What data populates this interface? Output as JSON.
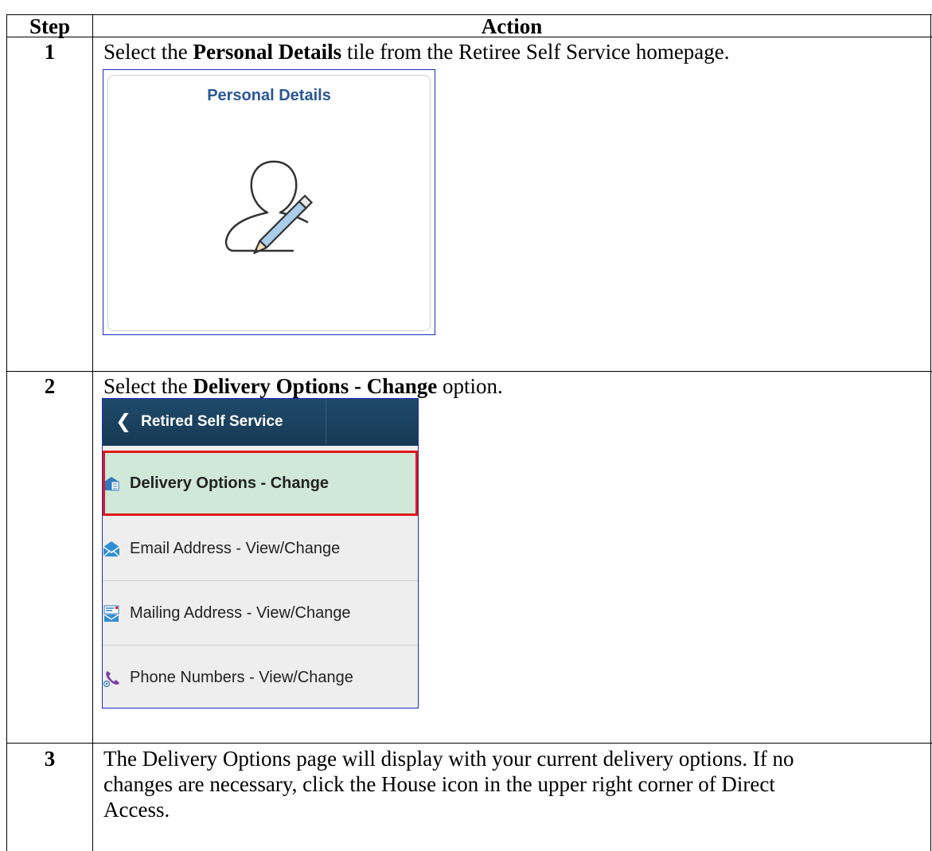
{
  "table": {
    "header": {
      "step": "Step",
      "action": "Action"
    },
    "rows": [
      {
        "step": "1",
        "text_pre": "Select the ",
        "text_bold": "Personal Details",
        "text_post": " tile from the Retiree Self Service homepage."
      },
      {
        "step": "2",
        "text_pre": "Select the ",
        "text_bold": "Delivery Options - Change",
        "text_post": " option."
      },
      {
        "step": "3",
        "line1": "The Delivery Options page will display with your current delivery options. If no",
        "line2": "changes are necessary, click the House icon in the upper right corner of Direct",
        "line3": "Access."
      }
    ]
  },
  "tile": {
    "title": "Personal Details",
    "icon": "person-edit-icon"
  },
  "nav": {
    "back_label": "Retired Self Service",
    "back_icon": "chevron-left-icon",
    "items": [
      {
        "label": "Delivery Options - Change",
        "icon": "delivery-options-icon",
        "selected": true
      },
      {
        "label": "Email Address - View/Change",
        "icon": "email-icon"
      },
      {
        "label": "Mailing Address - View/Change",
        "icon": "mailing-address-icon"
      },
      {
        "label": "Phone Numbers - View/Change",
        "icon": "phone-icon"
      }
    ]
  },
  "colors": {
    "tile_title": "#2b5797",
    "navbar": "#1f4a6a",
    "selected_bg": "#cfe8d8",
    "selected_border": "#e0191a",
    "screenshot_border": "#1a2bbf"
  }
}
